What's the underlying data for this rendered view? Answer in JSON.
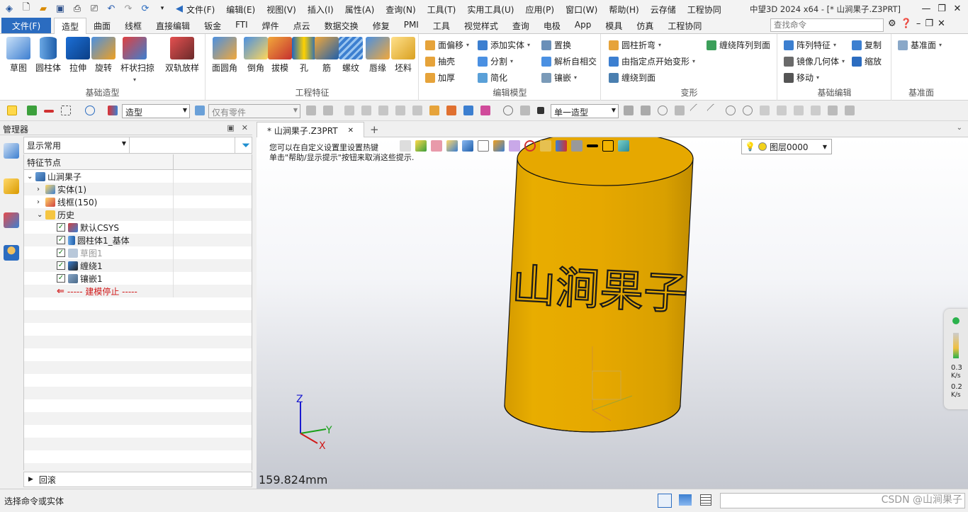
{
  "app": {
    "window_title": "中望3D 2024 x64 - [* 山涧果子.Z3PRT]",
    "search_placeholder": "查找命令"
  },
  "menubar": [
    "文件(F)",
    "编辑(E)",
    "视图(V)",
    "插入(I)",
    "属性(A)",
    "查询(N)",
    "工具(T)",
    "实用工具(U)",
    "应用(P)",
    "窗口(W)",
    "帮助(H)",
    "云存储",
    "工程协同"
  ],
  "tabs": {
    "file": "文件(F)",
    "items": [
      "造型",
      "曲面",
      "线框",
      "直接编辑",
      "钣金",
      "FTI",
      "焊件",
      "点云",
      "数据交换",
      "修复",
      "PMI",
      "工具",
      "视觉样式",
      "查询",
      "电极",
      "App",
      "模具",
      "仿真",
      "工程协同"
    ],
    "active": "造型"
  },
  "ribbon": {
    "g1": {
      "title": "基础造型",
      "btns": [
        "草图",
        "圆柱体",
        "拉伸",
        "旋转",
        "杆状扫掠",
        "双轨放样"
      ]
    },
    "g2": {
      "title": "工程特征",
      "btns": [
        "面圆角",
        "倒角",
        "拔模",
        "孔",
        "筋",
        "螺纹",
        "唇缘",
        "坯料"
      ]
    },
    "g3": {
      "title": "编辑模型",
      "items": [
        "面偏移",
        "添加实体",
        "置换",
        "抽壳",
        "分割",
        "解析自相交",
        "加厚",
        "简化",
        "镶嵌"
      ]
    },
    "g4": {
      "title": "变形",
      "items": [
        "圆柱折弯",
        "缠绕阵列到面",
        "由指定点开始变形",
        "缠绕到面"
      ]
    },
    "g5": {
      "title": "基础编辑",
      "items": [
        "阵列特征",
        "复制",
        "镜像几何体",
        "缩放",
        "移动"
      ]
    },
    "g6": {
      "title": "基准面",
      "items": [
        "基准面"
      ]
    }
  },
  "toolbar2": {
    "mode_combo": "造型",
    "filter_combo": "仅有零件",
    "type_combo": "单一造型"
  },
  "manager": {
    "title": "管理器",
    "filter_value": "显示常用",
    "column_header": "特征节点",
    "tree": {
      "root": "山涧果子",
      "solid": "实体(1)",
      "wireframe": "线框(150)",
      "history": "历史",
      "csys": "默认CSYS",
      "cylinder": "圆柱体1_基体",
      "sketch": "草图1",
      "wrap": "缠绕1",
      "inlay": "镶嵌1",
      "stop": "----- 建模停止 -----"
    },
    "rollback": "回滚"
  },
  "document": {
    "tab": "* 山涧果子.Z3PRT"
  },
  "viewport": {
    "hint1": "您可以在自定义设置里设置热键",
    "hint2": "单击\"帮助/显示提示\"按钮来取消这些提示.",
    "layer": "图层0000",
    "scale": "159.824mm",
    "engraved_text": "山涧果子",
    "axis_x": "X",
    "axis_y": "Y",
    "axis_z": "Z",
    "perf1_val": "0.3",
    "perf1_unit": "K/s",
    "perf2_val": "0.2",
    "perf2_unit": "K/s"
  },
  "status": {
    "text": "选择命令或实体",
    "watermark": "CSDN @山涧果子"
  },
  "colors": {
    "accent": "#2b6cc0",
    "body": "#e6a800",
    "stop": "#d01818"
  }
}
